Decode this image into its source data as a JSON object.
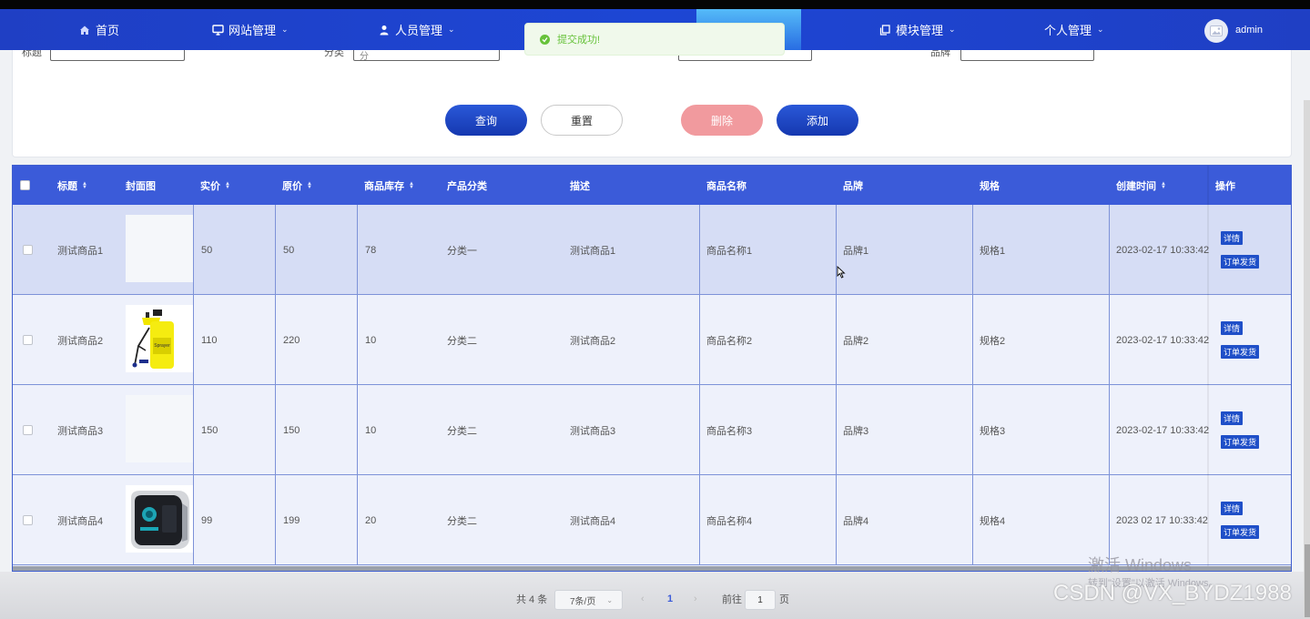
{
  "nav": {
    "items": [
      {
        "label": "首页",
        "icon": "home-icon",
        "dropdown": false
      },
      {
        "label": "网站管理",
        "icon": "monitor-icon",
        "dropdown": true
      },
      {
        "label": "人员管理",
        "icon": "user-icon",
        "dropdown": true
      },
      {
        "label": "模块管理",
        "icon": "copy-icon",
        "dropdown": true
      },
      {
        "label": "个人管理",
        "icon": "",
        "dropdown": true
      }
    ],
    "user": "admin"
  },
  "toast": {
    "text": "提交成功!",
    "color": "#67c23a"
  },
  "search": {
    "fields": [
      {
        "label": "标题",
        "value": ""
      },
      {
        "label": "分类",
        "value": "分"
      },
      {
        "label": "",
        "value": ""
      },
      {
        "label": "品牌",
        "value": ""
      }
    ],
    "buttons": {
      "query": "查询",
      "reset": "重置",
      "delete": "删除",
      "add": "添加"
    }
  },
  "table": {
    "headers": {
      "title": "标题",
      "cover": "封面图",
      "price": "实价",
      "orig": "原价",
      "stock": "商品库存",
      "category": "产品分类",
      "desc": "描述",
      "name": "商品名称",
      "brand": "品牌",
      "spec": "规格",
      "created": "创建时间",
      "ops": "操作"
    },
    "rows": [
      {
        "title": "测试商品1",
        "price": "50",
        "orig": "50",
        "stock": "78",
        "category": "分类一",
        "desc": "测试商品1",
        "name": "商品名称1",
        "brand": "品牌1",
        "spec": "规格1",
        "created": "2023-02-17 10:33:42",
        "cover": "blank"
      },
      {
        "title": "测试商品2",
        "price": "110",
        "orig": "220",
        "stock": "10",
        "category": "分类二",
        "desc": "测试商品2",
        "name": "商品名称2",
        "brand": "品牌2",
        "spec": "规格2",
        "created": "2023-02-17 10:33:42",
        "cover": "sprayer"
      },
      {
        "title": "测试商品3",
        "price": "150",
        "orig": "150",
        "stock": "10",
        "category": "分类二",
        "desc": "测试商品3",
        "name": "商品名称3",
        "brand": "品牌3",
        "spec": "规格3",
        "created": "2023-02-17 10:33:42",
        "cover": "blank"
      },
      {
        "title": "测试商品4",
        "price": "99",
        "orig": "199",
        "stock": "20",
        "category": "分类二",
        "desc": "测试商品4",
        "name": "商品名称4",
        "brand": "品牌4",
        "spec": "规格4",
        "created": "2023 02 17 10:33:42",
        "cover": "pc-case"
      }
    ],
    "op_detail": "详情",
    "op_ship": "订单发货"
  },
  "pager": {
    "total": "共 4 条",
    "page_size": "7条/页",
    "current": "1",
    "goto_label": "前往",
    "goto_value": "1",
    "goto_suffix": "页"
  },
  "watermarks": {
    "activate": "激活 Windows",
    "activate_sub": "转到\"设置\"以激活 Windows。",
    "csdn": "CSDN @VX_BYDZ1988"
  },
  "colors": {
    "nav": "#1f3fc4",
    "header": "#3b5bd9",
    "primary": "#1f4fc8",
    "danger": "#f19a9e"
  }
}
